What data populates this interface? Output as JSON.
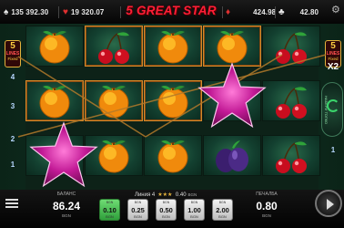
{
  "header": {
    "title": "5 GREAT STAR",
    "jackpots": [
      {
        "suit_icon": "spade-icon",
        "suit": "♠",
        "value": "135 392.30",
        "currency": "",
        "color": "#e8e8e8"
      },
      {
        "suit_icon": "heart-icon",
        "suit": "♥",
        "value": "19 320.07",
        "currency": "",
        "color": "#e03030"
      },
      {
        "suit_icon": "diamond-icon",
        "suit": "♦",
        "value": "424.98",
        "currency": "",
        "color": "#e03030"
      },
      {
        "suit_icon": "club-icon",
        "suit": "♣",
        "value": "42.80",
        "currency": "",
        "color": "#e8e8e8"
      }
    ],
    "settings_icon": "gear-icon"
  },
  "lines_badge": {
    "count": "5",
    "text": "LINES",
    "sub": "Fixed"
  },
  "left_line_numbers": [
    "4",
    "3",
    "2",
    "1"
  ],
  "right_line_numbers": [
    "4",
    "3",
    "1"
  ],
  "multiplier": "X2",
  "gamble_label": "НАБЕРИ ТОПКО",
  "reels": [
    [
      "orange",
      "orange",
      "star"
    ],
    [
      "cherry",
      "orange",
      "orange"
    ],
    [
      "orange",
      "orange",
      "orange"
    ],
    [
      "orange",
      "star",
      "plum"
    ],
    [
      "cherry",
      "cherry",
      "cherry"
    ]
  ],
  "bottom": {
    "balance_label": "БАЛАНС",
    "balance_value": "86.24",
    "balance_currency": "BGN",
    "win_label": "ПЕЧАЛБА",
    "win_value": "0.80",
    "win_currency": "BGN",
    "line_info_text": "Линия 4",
    "line_info_stars": "★★★",
    "line_info_value": "0.40",
    "line_info_currency": "BGN",
    "bets": [
      {
        "value": "0.10",
        "currency": "BGN",
        "selected": true
      },
      {
        "value": "0.25",
        "currency": "BGN",
        "selected": false
      },
      {
        "value": "0.50",
        "currency": "BGN",
        "selected": false
      },
      {
        "value": "1.00",
        "currency": "BGN",
        "selected": false
      },
      {
        "value": "2.00",
        "currency": "BGN",
        "selected": false
      }
    ],
    "spin_icon": "play-icon"
  }
}
